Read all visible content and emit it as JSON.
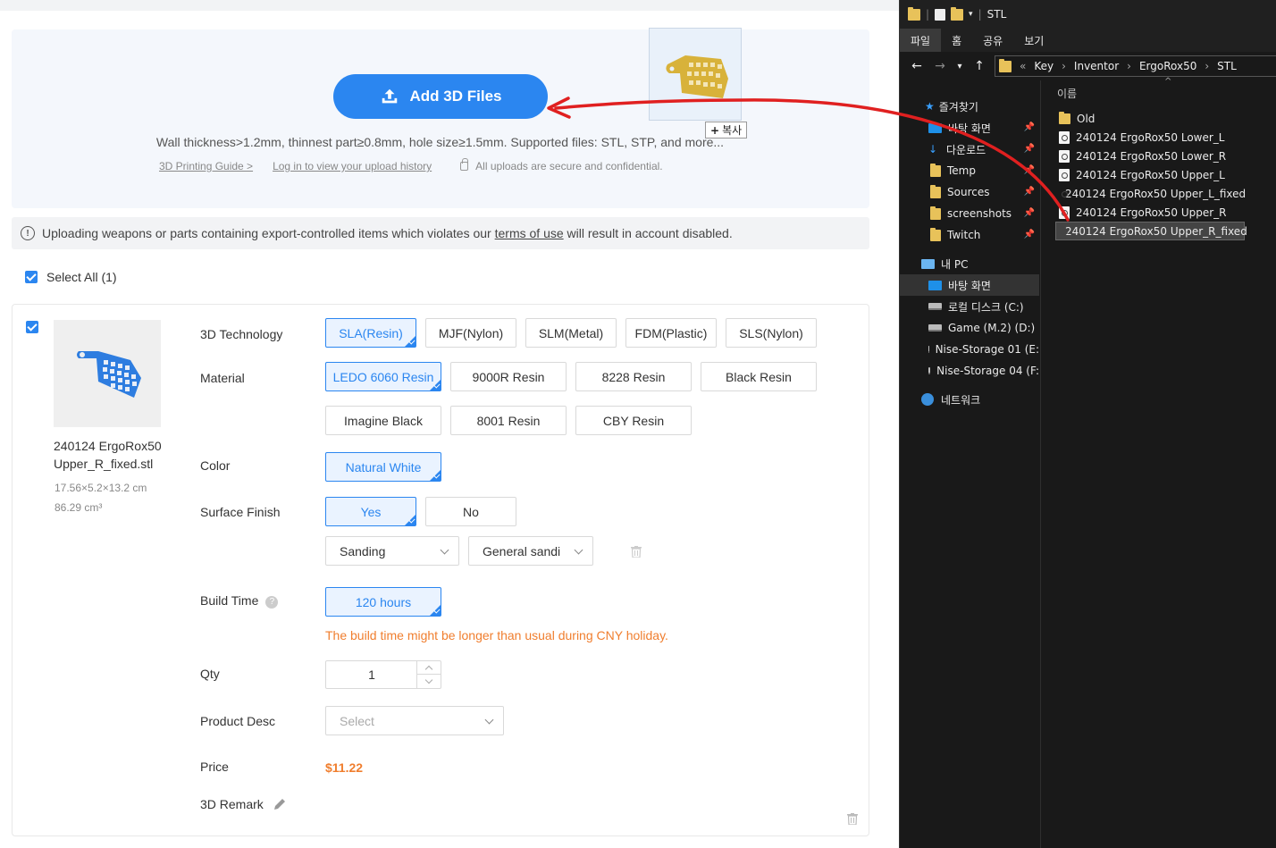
{
  "upload": {
    "add_label": "Add 3D Files",
    "desc": "Wall thickness>1.2mm, thinnest part≥0.8mm, hole size≥1.5mm. Supported files: STL, STP, and more...",
    "guide_link": "3D Printing Guide >",
    "login_link": "Log in to view your upload history",
    "secure_text": "All uploads are secure and confidential."
  },
  "warning": {
    "prefix": "Uploading weapons or parts containing export-controlled items which violates our",
    "link": "terms of use",
    "suffix": "will result in account disabled."
  },
  "select_all": "Select All (1)",
  "item": {
    "filename": "240124 ErgoRox50 Upper_R_fixed.stl",
    "dims": "17.56×5.2×13.2 cm",
    "volume": "86.29 cm³",
    "labels": {
      "tech": "3D Technology",
      "material": "Material",
      "color": "Color",
      "finish": "Surface Finish",
      "build": "Build Time",
      "qty": "Qty",
      "desc": "Product Desc",
      "price": "Price",
      "remark": "3D Remark"
    },
    "tech_options": [
      "SLA(Resin)",
      "MJF(Nylon)",
      "SLM(Metal)",
      "FDM(Plastic)",
      "SLS(Nylon)"
    ],
    "tech_selected": "SLA(Resin)",
    "material_options": [
      "LEDO 6060 Resin",
      "9000R Resin",
      "8228 Resin",
      "Black Resin",
      "Imagine Black",
      "8001 Resin",
      "CBY Resin"
    ],
    "material_selected": "LEDO 6060 Resin",
    "color_options": [
      "Natural White"
    ],
    "finish_options": [
      "Yes",
      "No"
    ],
    "finish_selected": "Yes",
    "finish_type": "Sanding",
    "finish_subtype": "General sandi",
    "build_time": "120 hours",
    "build_note": "The build time might be longer than usual during CNY holiday.",
    "qty": "1",
    "desc_placeholder": "Select",
    "price": "$11.22"
  },
  "drag": {
    "copy_label": "복사"
  },
  "explorer": {
    "title": "STL",
    "ribbon": [
      "파일",
      "홈",
      "공유",
      "보기"
    ],
    "breadcrumb": [
      "Key",
      "Inventor",
      "ErgoRox50",
      "STL"
    ],
    "nav": {
      "quick_access": "즐겨찾기",
      "desktop": "바탕 화면",
      "downloads": "다운로드",
      "temp": "Temp",
      "sources": "Sources",
      "screenshots": "screenshots",
      "twitch": "Twitch",
      "this_pc": "내 PC",
      "pc_desktop": "바탕 화면",
      "local_disk": "로컬 디스크 (C:)",
      "game": "Game (M.2) (D:)",
      "nise1": "Nise-Storage 01 (E:",
      "nise4": "Nise-Storage 04 (F:",
      "network": "네트워크"
    },
    "column_header": "이름",
    "files": [
      "Old",
      "240124 ErgoRox50 Lower_L",
      "240124 ErgoRox50 Lower_R",
      "240124 ErgoRox50 Upper_L",
      "240124 ErgoRox50 Upper_L_fixed",
      "240124 ErgoRox50 Upper_R",
      "240124 ErgoRox50 Upper_R_fixed"
    ],
    "selected_file": "240124 ErgoRox50 Upper_R_fixed"
  },
  "colors": {
    "accent": "#2b86f0",
    "orange": "#f07e2e",
    "arrow": "#e02020"
  }
}
